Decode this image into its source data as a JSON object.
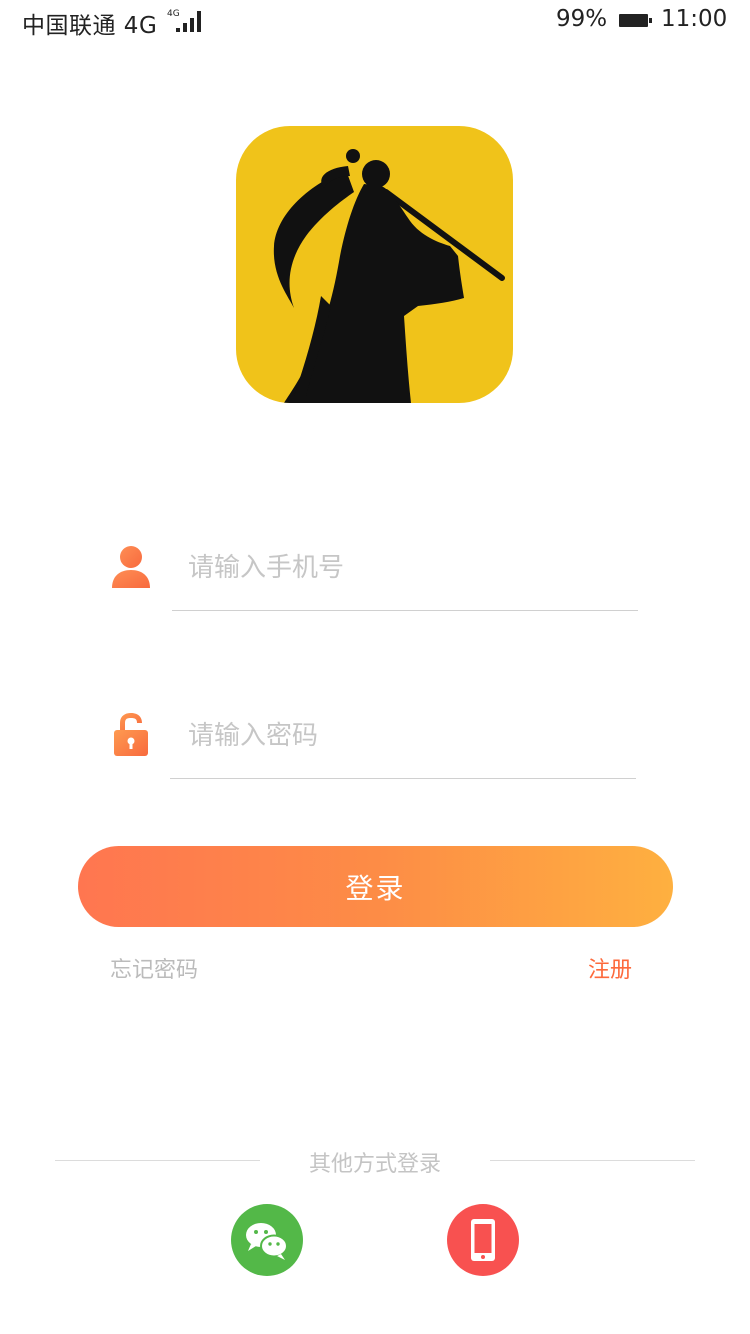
{
  "status_bar": {
    "carrier": "中国联通 4G",
    "network_small": "4G",
    "battery": "99%",
    "time": "11:00"
  },
  "logo": {
    "icon": "swordsman-silhouette-logo",
    "background": "#f0c31a"
  },
  "form": {
    "phone": {
      "icon": "user-icon",
      "placeholder": "请输入手机号",
      "value": ""
    },
    "password": {
      "icon": "lock-icon",
      "placeholder": "请输入密码",
      "value": ""
    }
  },
  "actions": {
    "login": "登录",
    "forgot_password": "忘记密码",
    "register": "注册"
  },
  "other_login": {
    "title": "其他方式登录",
    "methods": [
      {
        "icon": "wechat-icon",
        "color": "#53b848"
      },
      {
        "icon": "phone-icon",
        "color": "#f85150"
      }
    ]
  },
  "colors": {
    "accent_start": "#ff7650",
    "accent_end": "#feb040",
    "register_text": "#fd6a3c"
  }
}
